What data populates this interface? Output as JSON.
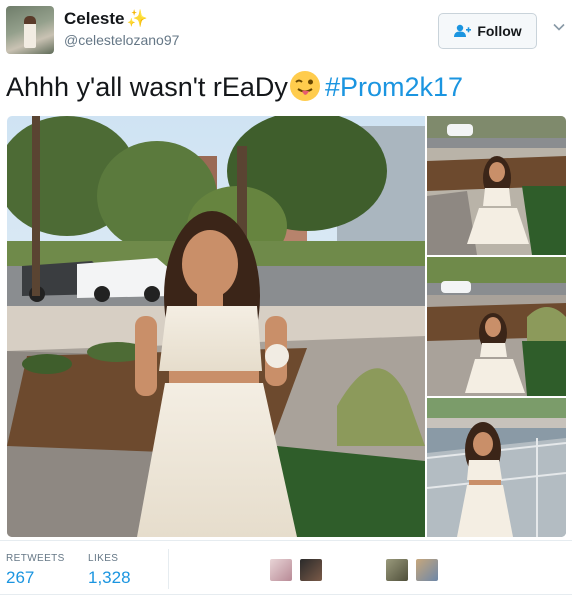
{
  "user": {
    "display_name": "Celeste",
    "name_emoji": "✨",
    "handle": "@celestelozano97",
    "avatar_icon": "profile-photo"
  },
  "follow_button": {
    "label": "Follow",
    "icon": "add-person-icon"
  },
  "tweet": {
    "text": "Ahhh y'all wasn't rEaDy",
    "emoji": "face-with-tongue-winking",
    "hashtag": "#Prom2k17"
  },
  "media": {
    "photo_count": 4,
    "photos": [
      "main-photo",
      "thumbnail-1",
      "thumbnail-2",
      "thumbnail-3"
    ]
  },
  "stats": {
    "retweets_label": "RETWEETS",
    "retweets_value": "267",
    "likes_label": "LIKES",
    "likes_value": "1,328"
  },
  "colors": {
    "accent": "#1b95e0",
    "muted": "#657786",
    "border": "#e6ecf0"
  }
}
